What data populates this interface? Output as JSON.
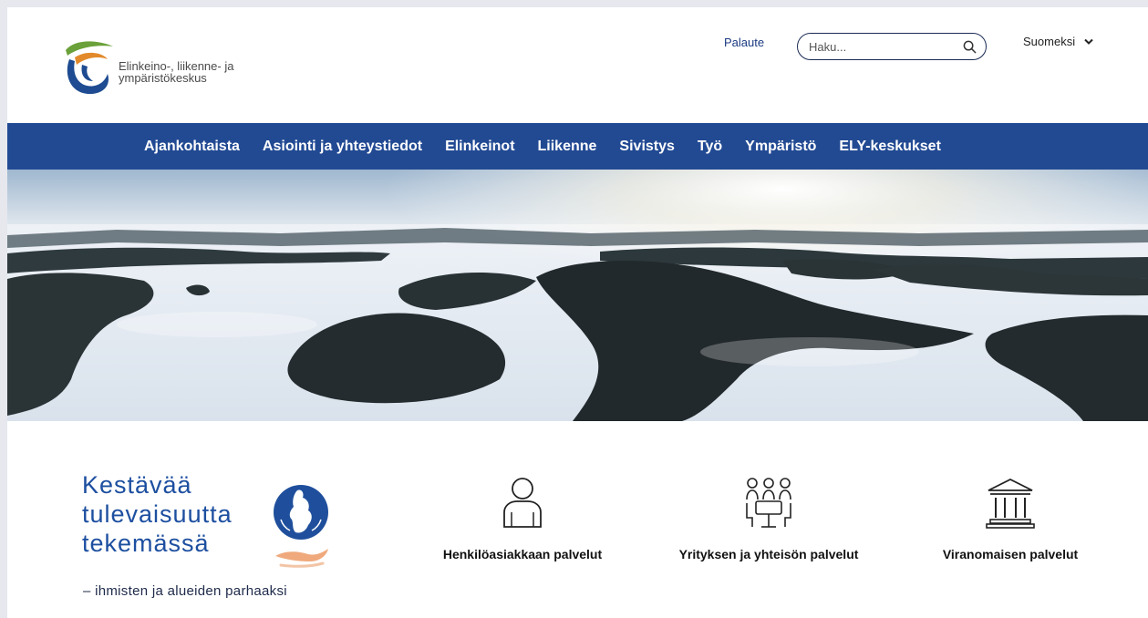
{
  "header": {
    "logo_line1": "Elinkeino-, liikenne- ja",
    "logo_line2": "ympäristökeskus",
    "feedback_link": "Palaute",
    "search_placeholder": "Haku...",
    "language": "Suomeksi"
  },
  "nav": {
    "items": [
      {
        "label": "Ajankohtaista"
      },
      {
        "label": "Asiointi ja yhteystiedot"
      },
      {
        "label": "Elinkeinot"
      },
      {
        "label": "Liikenne"
      },
      {
        "label": "Sivistys"
      },
      {
        "label": "Työ"
      },
      {
        "label": "Ympäristö"
      },
      {
        "label": "ELY-keskukset"
      }
    ]
  },
  "tagline": {
    "line1": "Kestävää",
    "line2": "tulevaisuutta",
    "line3": "tekemässä",
    "subline": "– ihmisten ja alueiden parhaaksi"
  },
  "services": [
    {
      "label": "Henkilöasiakkaan palvelut",
      "icon": "person-icon"
    },
    {
      "label": "Yrityksen ja yhteisön palvelut",
      "icon": "meeting-icon"
    },
    {
      "label": "Viranomaisen palvelut",
      "icon": "government-building-icon"
    }
  ],
  "colors": {
    "nav_background": "#224a93",
    "tagline": "#1d4fa0",
    "logo_green": "#6aa13a",
    "logo_orange": "#e28a2b",
    "logo_blue": "#1e4b91"
  }
}
